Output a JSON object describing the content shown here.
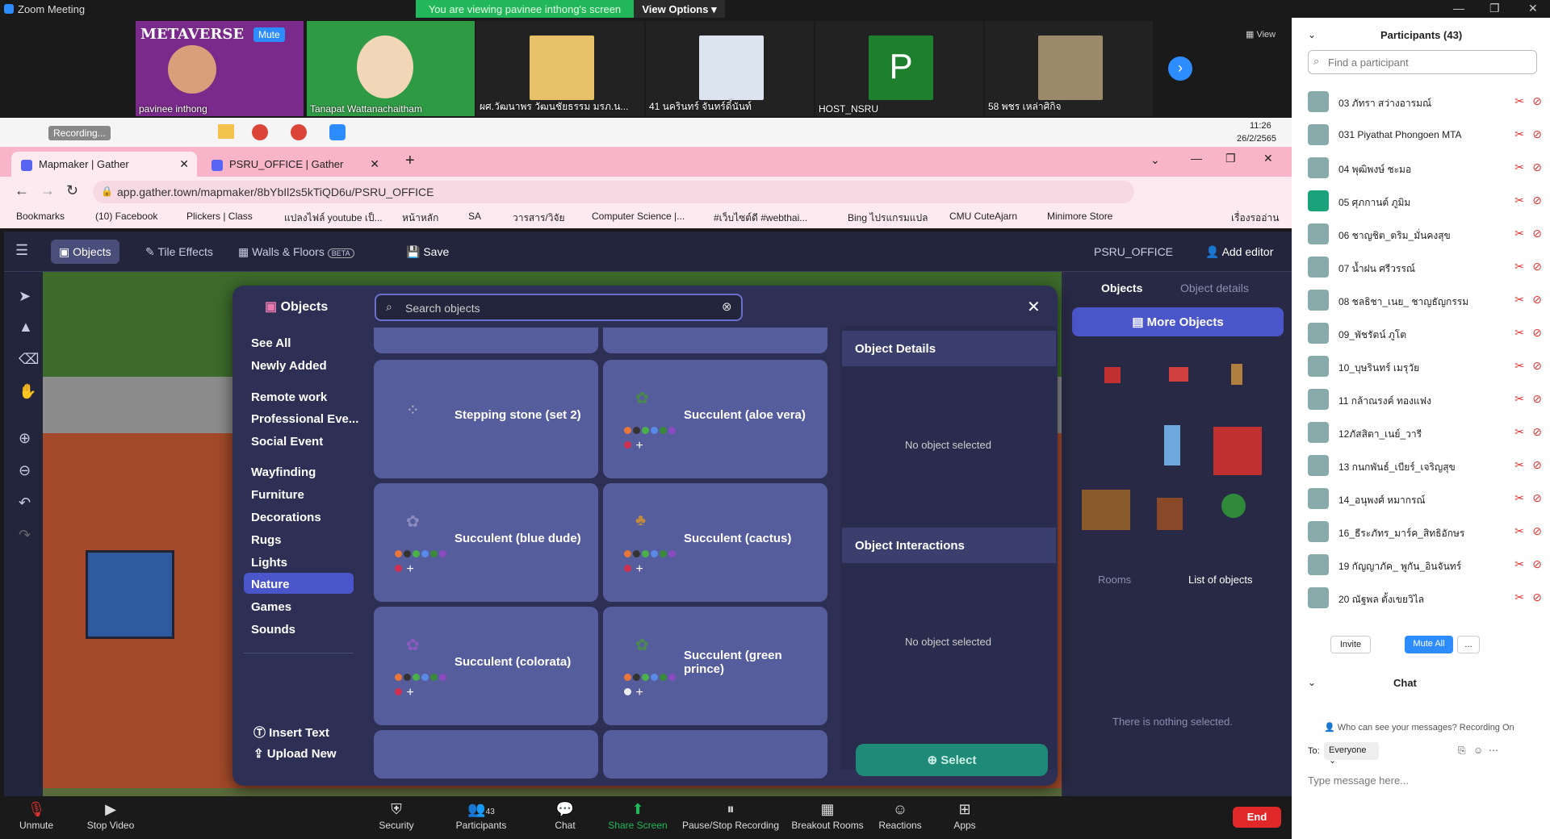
{
  "window": {
    "title": "Zoom Meeting"
  },
  "sharing": {
    "banner": "You are viewing pavinee inthong's screen",
    "view_options": "View Options"
  },
  "thumbnails": [
    {
      "name": "pavinee inthong",
      "overlay": "Mute",
      "bg": "#9b2c8f"
    },
    {
      "name": "Tanapat Wattanachaitham",
      "bg": "#3aa04a"
    },
    {
      "name": "ผศ.วัฒนาพร วัฒนชัยธรรม มรภ.น...",
      "bg": "#e8c06a"
    },
    {
      "name": "41 นครินทร์ จันทร์ดิ์นันท์",
      "bg": "#dbe4ef"
    },
    {
      "name": "HOST_NSRU",
      "initial": "P",
      "bg": "#1e7f2c"
    },
    {
      "name": "58 พชร เหล่าศิกิจ",
      "bg": "#9b8a6a"
    }
  ],
  "view_label": "View",
  "taskbar": {
    "recording": "Recording...",
    "time": "11:26",
    "date": "26/2/2565"
  },
  "tabs": [
    {
      "title": "Mapmaker | Gather"
    },
    {
      "title": "PSRU_OFFICE | Gather"
    }
  ],
  "url": "app.gather.town/mapmaker/8bYbIl2s5kTiQD6u/PSRU_OFFICE",
  "bookmarks": [
    "Bookmarks",
    "(10) Facebook",
    "Plickers | Class",
    "แปลงไฟล์ youtube เป็...",
    "หน้าหลัก",
    "SA",
    "วารสาร/วิจัย",
    "Computer Science |...",
    "#เว็บไซต์ดี #webthai...",
    "Bing ไปรแกรมแปล",
    "CMU CuteAjarn",
    "Minimore Store",
    "เรื่องรออ่าน"
  ],
  "gather": {
    "toolbar": {
      "objects": "Objects",
      "tile_effects": "Tile Effects",
      "walls_floors": "Walls & Floors",
      "beta": "BETA",
      "save": "Save",
      "space": "PSRU_OFFICE",
      "add_editor": "Add editor"
    },
    "right_panel": {
      "tab_objects": "Objects",
      "tab_details": "Object details",
      "more_objects": "More Objects",
      "rooms": "Rooms",
      "list_objects": "List of objects",
      "nothing": "There is nothing selected."
    }
  },
  "modal": {
    "title": "Objects",
    "search_placeholder": "Search objects",
    "categories": [
      "See All",
      "Newly Added",
      "Remote work",
      "Professional Eve...",
      "Social Event",
      "Wayfinding",
      "Furniture",
      "Decorations",
      "Rugs",
      "Lights",
      "Nature",
      "Games",
      "Sounds"
    ],
    "selected_category": "Nature",
    "insert_text": "Insert Text",
    "upload_new": "Upload New",
    "cards": [
      {
        "name": "Stepping stone (set 2)",
        "variants": false
      },
      {
        "name": "Succulent (aloe vera)",
        "variants": true
      },
      {
        "name": "Succulent (blue dude)",
        "variants": true
      },
      {
        "name": "Succulent (cactus)",
        "variants": true
      },
      {
        "name": "Succulent (colorata)",
        "variants": true
      },
      {
        "name": "Succulent (green prince)",
        "variants": true
      }
    ],
    "details_title": "Object Details",
    "details_empty": "No object selected",
    "interactions_title": "Object Interactions",
    "interactions_empty": "No object selected",
    "select": "Select"
  },
  "zoom_bar": {
    "unmute": "Unmute",
    "stop_video": "Stop Video",
    "security": "Security",
    "participants": "Participants",
    "participants_count": "43",
    "chat": "Chat",
    "share_screen": "Share Screen",
    "pause_recording": "Pause/Stop Recording",
    "breakout": "Breakout Rooms",
    "reactions": "Reactions",
    "apps": "Apps",
    "end": "End"
  },
  "participants_panel": {
    "title": "Participants (43)",
    "search_placeholder": "Find a participant",
    "list": [
      "03 ภัทรา สว่างอารมณ์",
      "031 Piyathat Phongoen MTA",
      "04 พุฒิพงษ์ ชะมอ",
      "05 ศุภกานต์ ภูมิม",
      "06 ชาญชิต_ตริม_มั่นคงสุข",
      "07 น้ำฝน ศรีวรรณ์",
      "08 ชลธิชา_เนย_ ชาญธัญกรรม",
      "09_พัชรัตน์ ภูโต",
      "10_บุษรินทร์ เมรุวัย",
      "11 กล้าณรงค์ ทองแฟง",
      "12ภัสสิตา_เนย์_วารี",
      "13 กนกพันธ์_เบียร์_เจริญสุข",
      "14_อนุพงศ์ หมากรณ์",
      "16_ธีระภัทร_มาร์ค_สิทธิอักษร",
      "19 กัญญาภัค_ พูกัน_อินจันทร์",
      "20 ณัฐพล ตั้งเขยวิไล"
    ],
    "invite": "Invite",
    "mute_all": "Mute All",
    "more": "...",
    "chat_title": "Chat",
    "chat_notice": "Who can see your messages? Recording On",
    "to_label": "To:",
    "to_value": "Everyone",
    "message_placeholder": "Type message here..."
  }
}
